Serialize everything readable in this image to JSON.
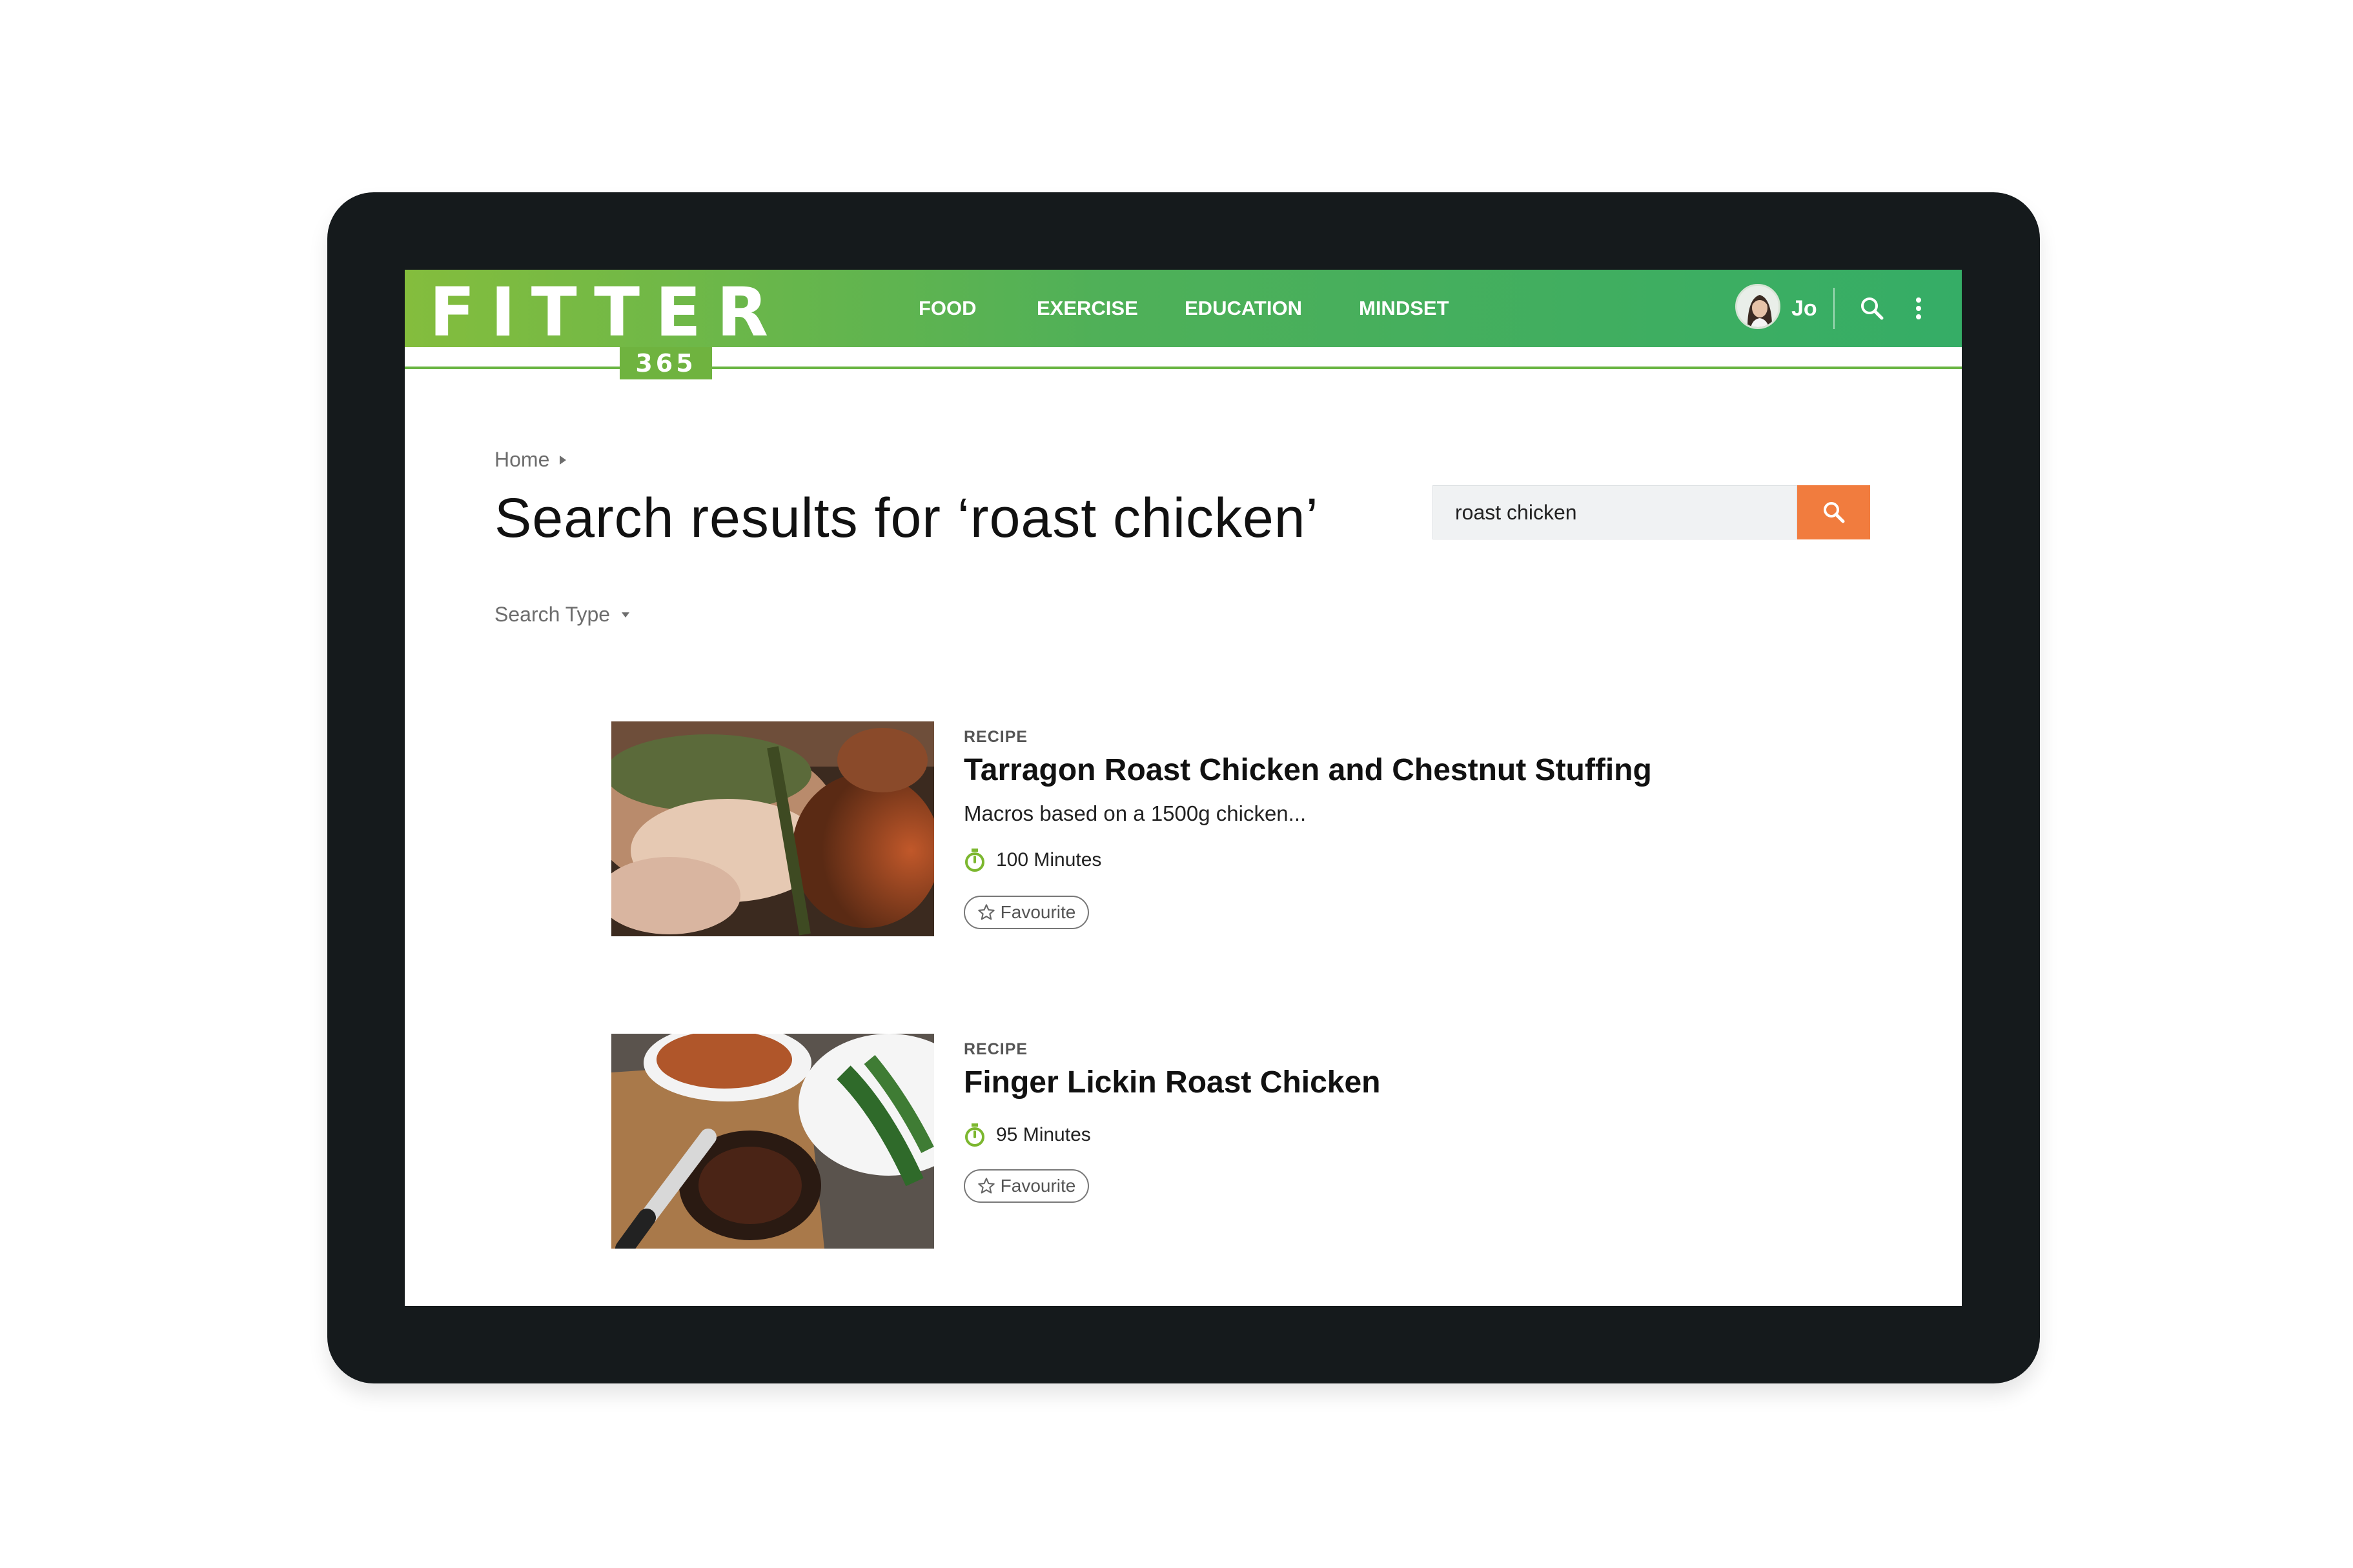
{
  "header": {
    "logo_text": "FITTER",
    "logo_badge": "365",
    "nav": [
      {
        "label": "FOOD"
      },
      {
        "label": "EXERCISE"
      },
      {
        "label": "EDUCATION"
      },
      {
        "label": "MINDSET"
      }
    ],
    "user_name": "Jo",
    "icons": [
      "search-icon",
      "more-vertical-icon"
    ]
  },
  "breadcrumb": {
    "home": "Home"
  },
  "page_title": "Search results for ‘roast chicken’",
  "search": {
    "value": "roast chicken"
  },
  "filter": {
    "label": "Search Type"
  },
  "results": [
    {
      "type": "RECIPE",
      "title": "Tarragon Roast Chicken and Chestnut Stuffing",
      "description": "Macros based on a 1500g chicken...",
      "time": "100 Minutes",
      "favourite_label": "Favourite"
    },
    {
      "type": "RECIPE",
      "title": "Finger Lickin Roast Chicken",
      "time": "95 Minutes",
      "favourite_label": "Favourite"
    }
  ],
  "colors": {
    "brand_green": "#6fb33f",
    "header_gradient_end": "#35ad66",
    "accent_orange": "#f17c3e",
    "device_frame": "#151a1c"
  }
}
